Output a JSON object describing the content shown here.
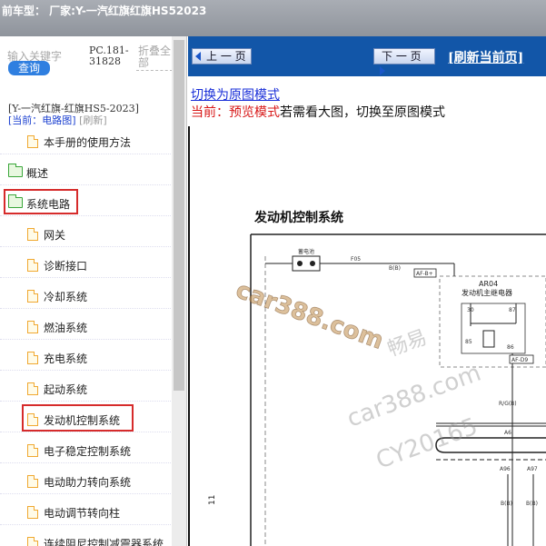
{
  "topbar": {
    "title": "前车型： 厂家:Y-一汽红旗红旗HS52023"
  },
  "sidebar": {
    "search_placeholder": "输入关键字",
    "search_button": "查询",
    "pc_code": "PC.181-31828",
    "fold_all": "折叠全部",
    "model": "[Y-一汽红旗-红旗HS5-2023]",
    "current": "[当前：电路图]",
    "refresh": "[刷新]",
    "items": [
      {
        "label": "本手册的使用方法",
        "icon": "document-icon"
      },
      {
        "label": "概述",
        "icon": "folder-icon"
      },
      {
        "label": "系统电路",
        "icon": "folder-open-icon"
      },
      {
        "label": "网关",
        "icon": "document-icon"
      },
      {
        "label": "诊断接口",
        "icon": "document-icon"
      },
      {
        "label": "冷却系统",
        "icon": "document-icon"
      },
      {
        "label": "燃油系统",
        "icon": "document-icon"
      },
      {
        "label": "充电系统",
        "icon": "document-icon"
      },
      {
        "label": "起动系统",
        "icon": "document-icon"
      },
      {
        "label": "发动机控制系统",
        "icon": "document-icon"
      },
      {
        "label": "电子稳定控制系统",
        "icon": "document-icon"
      },
      {
        "label": "电动助力转向系统",
        "icon": "document-icon"
      },
      {
        "label": "电动调节转向柱",
        "icon": "document-icon"
      },
      {
        "label": "连续阻尼控制减震器系统",
        "icon": "document-icon"
      }
    ]
  },
  "toolbar": {
    "prev": "上 一 页",
    "next": "下 一 页",
    "refresh": "[刷新当前页]"
  },
  "content": {
    "switch_link": "切换为原图模式",
    "mode_current": "当前：预览模式",
    "mode_hint": "若需看大图，切换至原图模式"
  },
  "diagram": {
    "title": "发动机控制系统",
    "battery": "蓄电池",
    "fuse": "F05",
    "wire_bb": "B(B)",
    "connector_afb": "AF-B+",
    "relay_id": "AR04",
    "relay_name": "发动机主继电器",
    "pin30": "30",
    "pin87": "87",
    "pin85": "85",
    "pin86": "86",
    "connector_afd9": "AF-D9",
    "wire_rgb": "R/G(B)",
    "pin_a6": "A6",
    "pin_a96": "A96",
    "pin_a97": "A97",
    "wire_b1": "B(B)",
    "wire_b2": "B(B)",
    "side_mark": "11"
  },
  "watermarks": {
    "w1": "car388.com",
    "w2": "畅易",
    "w3": "car388.com",
    "w4": "CY20165"
  },
  "colors": {
    "accent_blue": "#1256a8",
    "highlight_red": "#d62b2b",
    "search_blue": "#2f7fe0"
  }
}
